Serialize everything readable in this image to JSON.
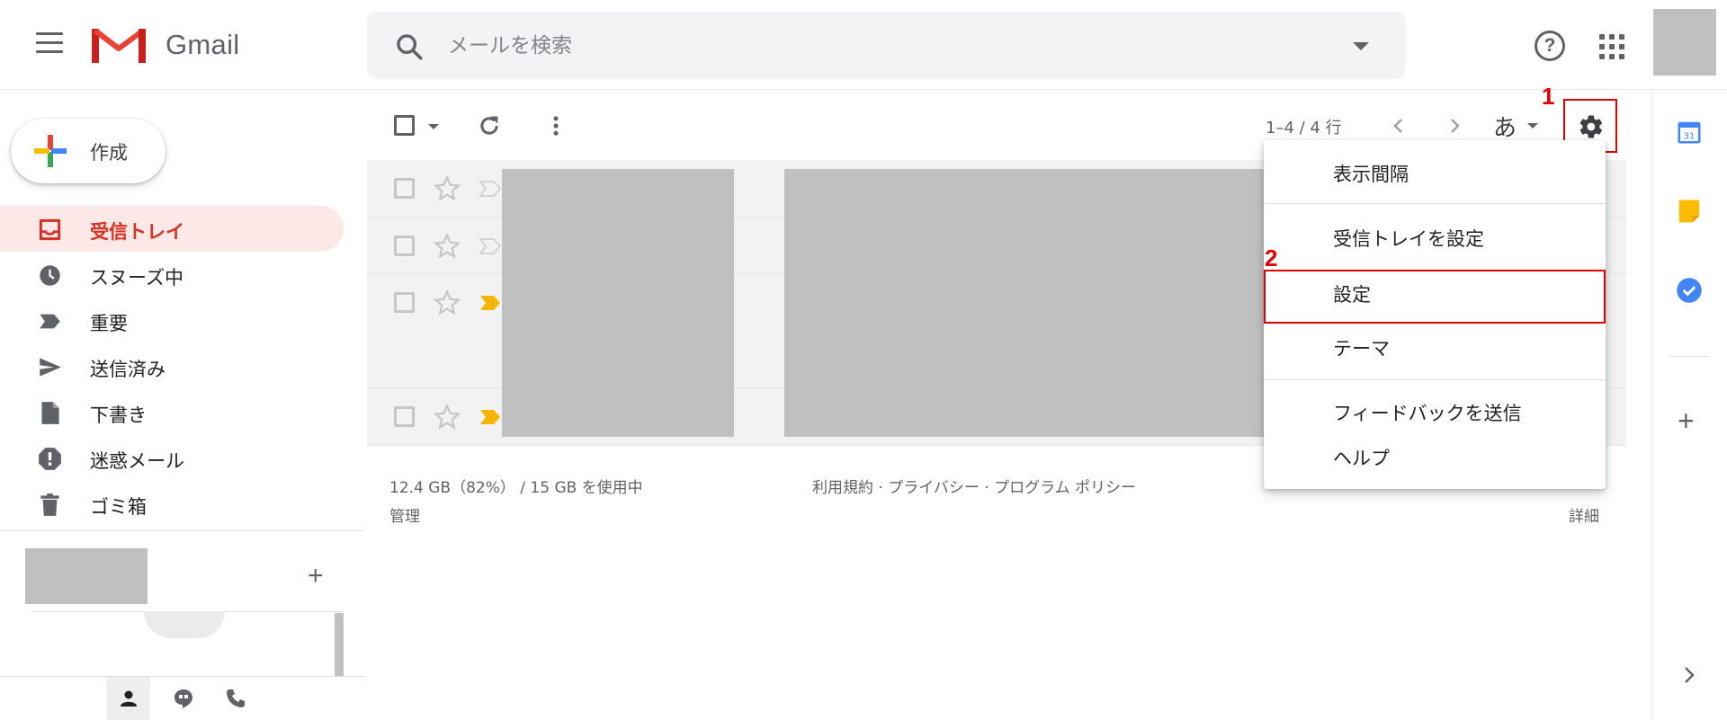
{
  "header": {
    "app_name": "Gmail",
    "search_placeholder": "メールを検索",
    "help_symbol": "?"
  },
  "sidebar": {
    "compose_label": "作成",
    "items": [
      {
        "label": "受信トレイ",
        "icon": "inbox-icon",
        "active": true
      },
      {
        "label": "スヌーズ中",
        "icon": "clock-icon",
        "active": false
      },
      {
        "label": "重要",
        "icon": "important-label-icon",
        "active": false
      },
      {
        "label": "送信済み",
        "icon": "send-icon",
        "active": false
      },
      {
        "label": "下書き",
        "icon": "draft-icon",
        "active": false
      },
      {
        "label": "迷惑メール",
        "icon": "spam-icon",
        "active": false
      },
      {
        "label": "ゴミ箱",
        "icon": "trash-icon",
        "active": false
      }
    ],
    "hangouts_add": "+"
  },
  "toolbar": {
    "pagination": "1–4 / 4 行",
    "input_tool": "あ"
  },
  "menu": {
    "items": [
      "表示間隔",
      "受信トレイを設定",
      "設定",
      "テーマ",
      "フィードバックを送信",
      "ヘルプ"
    ]
  },
  "callouts": {
    "gear": "1",
    "settings": "2"
  },
  "footer": {
    "storage": "12.4 GB（82%） / 15 GB を使用中",
    "manage": "管理",
    "links": "利用規約 · プライバシー · プログラム ポリシー",
    "details": "詳細"
  },
  "side_panel": {
    "calendar_day": "31",
    "add": "+"
  },
  "colors": {
    "accent_red": "#d93025",
    "callout_red": "#e00000",
    "active_bg": "#fce8e6",
    "important_yellow": "#f4b400"
  }
}
